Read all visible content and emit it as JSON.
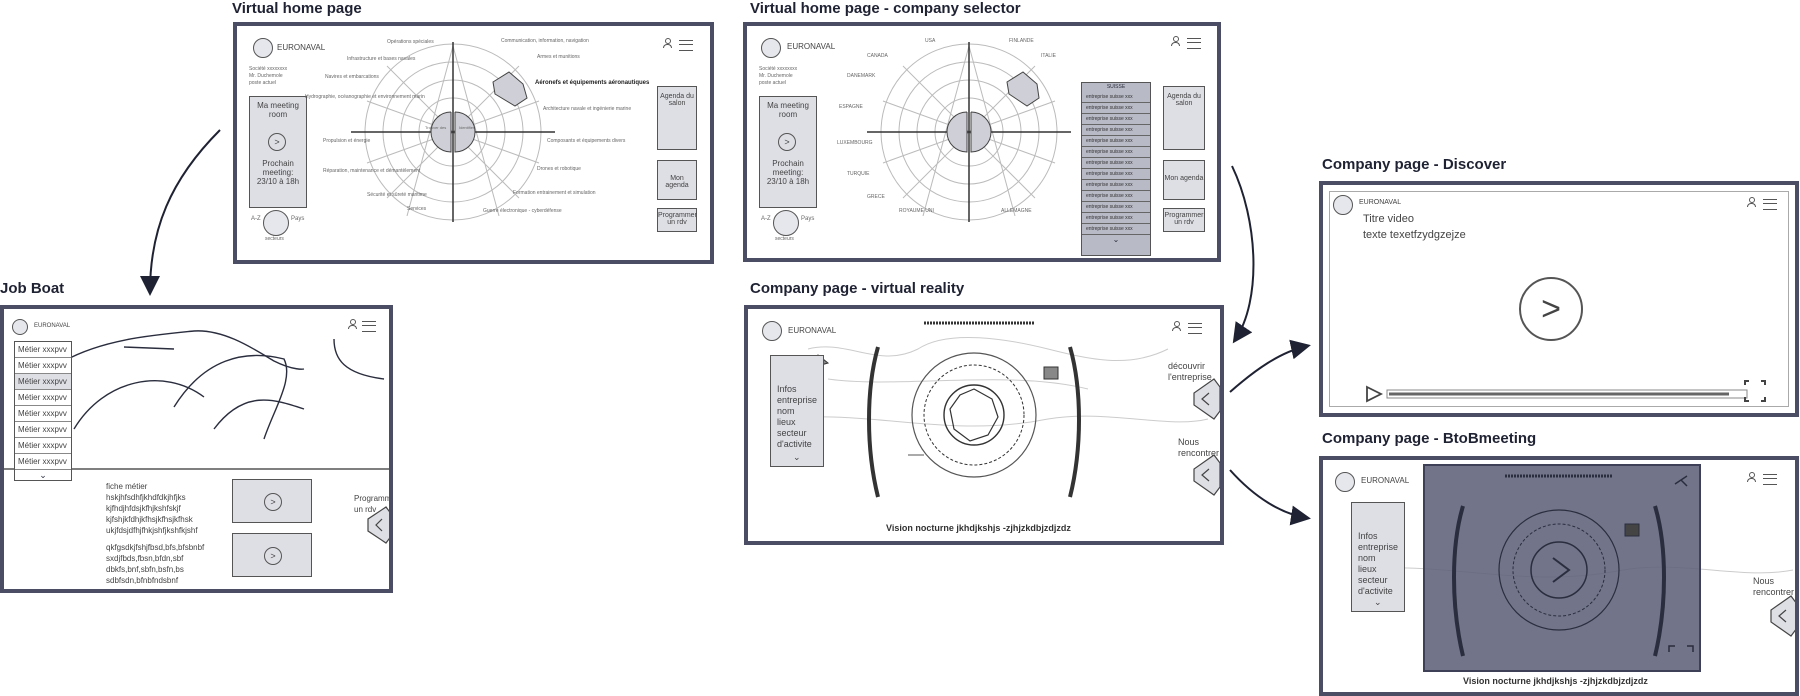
{
  "screens": {
    "home": {
      "title": "Virtual home page",
      "brand": "EURONAVAL",
      "user": [
        "Société xxxxxxxx",
        "Mr. Duchemole",
        "poste actuel"
      ],
      "meeting_room": [
        "Ma meeting",
        "room"
      ],
      "next_meeting": [
        "Prochain",
        "meeting:",
        "23/10 à 18h"
      ],
      "az": "A-Z",
      "pays": "Pays",
      "secteurs": "secteurs",
      "center_left": [
        "Trouver des",
        "contacts"
      ],
      "center_right": [
        "Identifier",
        "les entreprises"
      ],
      "buttons": [
        "Agenda du salon",
        "Mon agenda",
        "Programmer un rdv"
      ],
      "left_labels": [
        "Opérations spéciales",
        "Infrastructure et bases navales",
        "Navires et embarcations",
        "Hydrographie, océanographie et environnement marin",
        "Propulsion et énergie",
        "Réparation, maintenance et démantèlement",
        "Sécurité et sûreté maritime",
        "Services"
      ],
      "right_labels": [
        "Communication, information, navigation",
        "Armes et munitions",
        "Aéronefs et équipements aéronautiques",
        "Architecture navale et ingénierie marine",
        "Composants et équipements divers",
        "Drones et robotique",
        "Formation entrainement et simulation",
        "Guerre électronique - cyberdéfense"
      ]
    },
    "selector": {
      "title": "Virtual home page - company selector",
      "brand": "EURONAVAL",
      "user": [
        "Société xxxxxxxx",
        "Mr. Duchemole",
        "poste actuel"
      ],
      "meeting_room": [
        "Ma meeting",
        "room"
      ],
      "next_meeting": [
        "Prochain",
        "meeting:",
        "23/10 à 18h"
      ],
      "az": "A-Z",
      "pays": "Pays",
      "secteurs": "secteurs",
      "countries_left": [
        "USA",
        "CANADA",
        "DANEMARK",
        "ESPAGNE",
        "LUXEMBOURG",
        "TURQUIE",
        "GRECE",
        "ROYAUME UNI"
      ],
      "countries_right": [
        "FINLANDE",
        "ITALIE",
        "ALLEMAGNE"
      ],
      "panel_title": "SUISSE",
      "panel_item": "entreprise suisse xxx",
      "buttons": [
        "Agenda du salon",
        "Mon agenda",
        "Programmer un rdv"
      ]
    },
    "jobboat": {
      "title": "Job Boat",
      "brand": "EURONAVAL",
      "job_item": "Métier xxxpvv",
      "para1": [
        "fiche métier",
        "hskjhfsdhfjkhdfdkjhfjks",
        "kjfhdjhfdsjkfhjkshfskjf",
        "kjfshjkfdhjkfhsjkfhsjkfhsk",
        "ukjfdsjdfhjfhkjshfjkshfkjshf"
      ],
      "para2": [
        "qkfgsdkjfshjfbsd,bfs,bfsbnbf",
        "sxdjfbds,fbsn,bfdn,sbf",
        "dbkfs,bnf,sbfn,bsfn,bs",
        "sdbfsdn,bfnbfndsbnf"
      ],
      "side_text": [
        "Programmer",
        "un rdv"
      ]
    },
    "vr": {
      "title": "Company page - virtual reality",
      "brand": "EURONAVAL",
      "infos": [
        "Infos",
        "entreprise",
        "nom",
        "lieux",
        "secteur",
        "d'activite"
      ],
      "discover": [
        "découvrir",
        "l'entreprise"
      ],
      "meet": [
        "Nous",
        "rencontrer"
      ],
      "caption": "Vision nocturne jkhdjkshjs -zjhjzkdbjzdjzdz"
    },
    "discover": {
      "title": "Company page - Discover",
      "brand": "EURONAVAL",
      "video_title": "Titre video",
      "video_text": "texte texetfzydgzejze"
    },
    "btob": {
      "title": "Company page - BtoBmeeting",
      "brand": "EURONAVAL",
      "infos": [
        "Infos",
        "entreprise",
        "nom",
        "lieux",
        "secteur",
        "d'activite"
      ],
      "meet": [
        "Nous",
        "rencontrer"
      ],
      "caption": "Vision nocturne jkhdjkshjs -zjhjzkdbjzdjzdz"
    }
  },
  "colors": {
    "frame": "#4a4d63",
    "overlay": "#6b6e86",
    "panel": "#dedfe5"
  }
}
